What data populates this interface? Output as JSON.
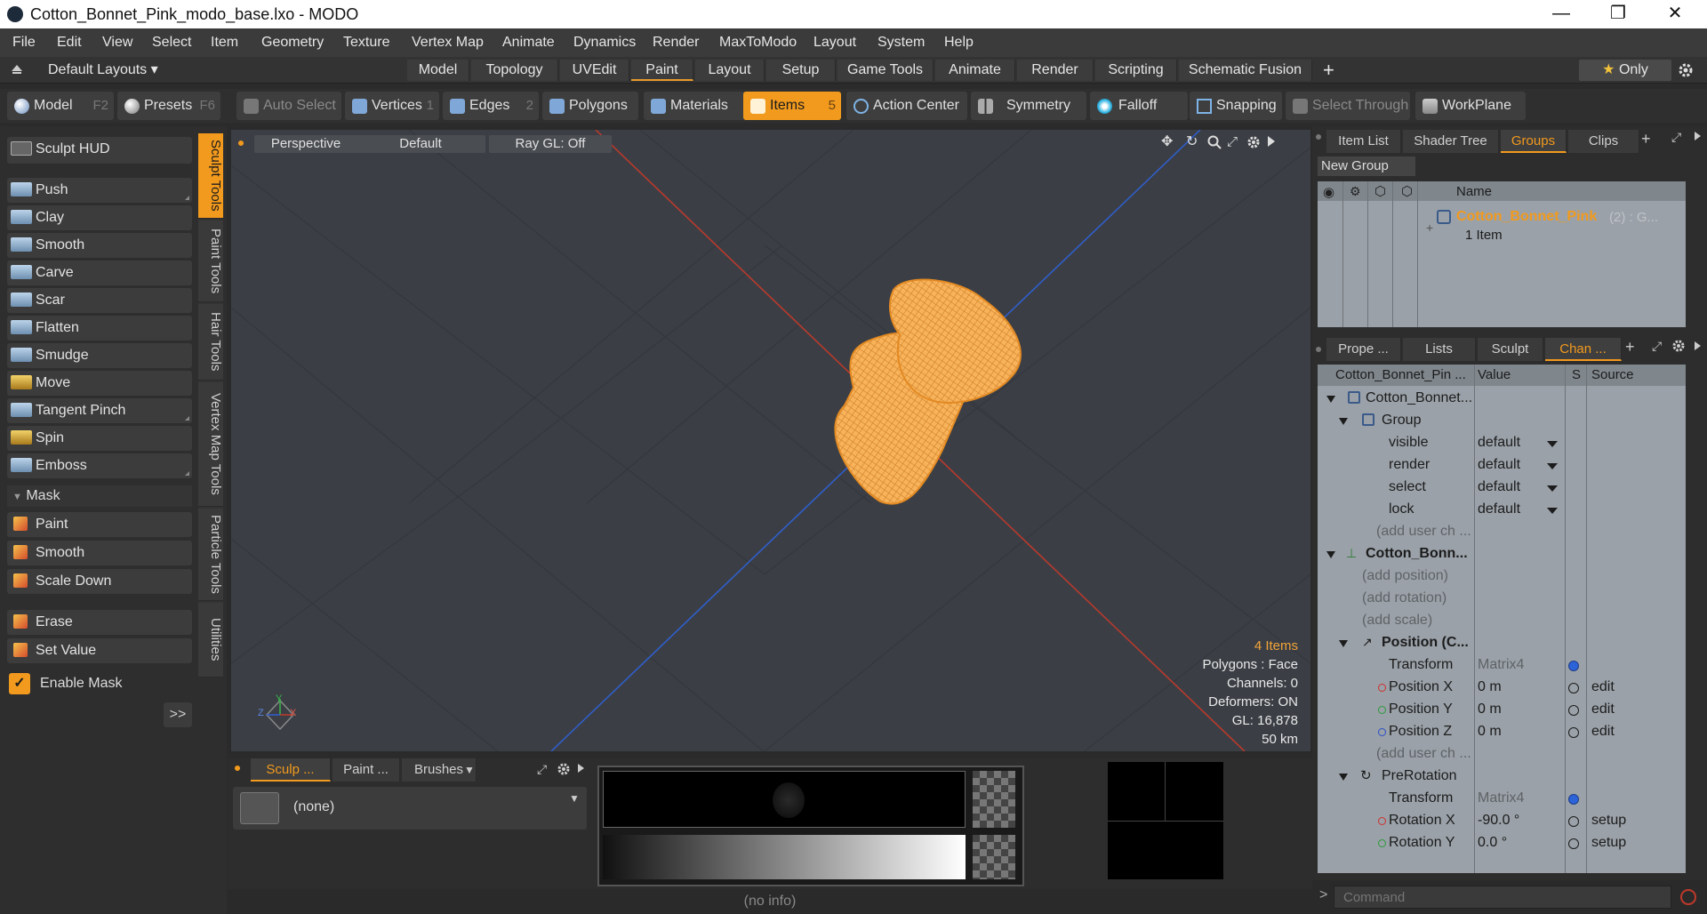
{
  "window": {
    "title": "Cotton_Bonnet_Pink_modo_base.lxo - MODO",
    "minimize": "—",
    "maximize": "❐",
    "close": "✕"
  },
  "menu": [
    "File",
    "Edit",
    "View",
    "Select",
    "Item",
    "Geometry",
    "Texture",
    "Vertex Map",
    "Animate",
    "Dynamics",
    "Render",
    "MaxToModo",
    "Layout",
    "System",
    "Help"
  ],
  "layoutbar": {
    "layouts_label": "Default Layouts",
    "tabs": [
      "Model",
      "Topology",
      "UVEdit",
      "Paint",
      "Layout",
      "Setup",
      "Game Tools",
      "Animate",
      "Render",
      "Scripting",
      "Schematic Fusion"
    ],
    "active_tab": "Paint",
    "add": "+",
    "only": "Only",
    "star": "★"
  },
  "toolbar": {
    "model": "Model",
    "model_key": "F2",
    "presets": "Presets",
    "presets_key": "F6",
    "auto_select": "Auto Select",
    "vertices": "Vertices",
    "vertices_count": "1",
    "edges": "Edges",
    "edges_count": "2",
    "polygons": "Polygons",
    "materials": "Materials",
    "items": "Items",
    "items_count": "5",
    "action_center": "Action Center",
    "symmetry": "Symmetry",
    "falloff": "Falloff",
    "snapping": "Snapping",
    "select_through": "Select Through",
    "workplane": "WorkPlane"
  },
  "sculpt": {
    "hud": "Sculpt HUD",
    "tools": [
      "Push",
      "Clay",
      "Smooth",
      "Carve",
      "Scar",
      "Flatten",
      "Smudge",
      "Move",
      "Tangent Pinch",
      "Spin",
      "Emboss"
    ],
    "mask_header": "Mask",
    "mask_tools": [
      "Paint",
      "Smooth",
      "Scale Down"
    ],
    "more_tools": [
      "Erase",
      "Set Value"
    ],
    "enable_mask": "Enable Mask",
    "expand": ">>",
    "vtabs": [
      "Sculpt Tools",
      "Paint Tools",
      "Hair Tools",
      "Vertex Map Tools",
      "Particle Tools",
      "Utilities"
    ]
  },
  "viewport": {
    "perspective": "Perspective",
    "default": "Default",
    "raygl": "Ray GL: Off",
    "stats": {
      "items": "4 Items",
      "polygons": "Polygons : Face",
      "channels": "Channels: 0",
      "deformers": "Deformers: ON",
      "gl": "GL: 16,878",
      "scale": "50 km"
    },
    "axis_x": "X",
    "axis_y": "Y",
    "axis_z": "Z"
  },
  "groups_panel": {
    "tabs": [
      "Item List",
      "Shader Tree",
      "Groups",
      "Clips"
    ],
    "active": "Groups",
    "new_group": "New Group",
    "name_header": "Name",
    "group_name": "Cotton_Bonnet_Pink",
    "group_suffix": "(2) : G...",
    "group_sub": "1 Item"
  },
  "channels_panel": {
    "tabs": [
      "Prope ...",
      "Lists",
      "Sculpt",
      "Chan ..."
    ],
    "active": "Chan ...",
    "headers": {
      "name": "Cotton_Bonnet_Pin ...",
      "value": "Value",
      "s": "S",
      "source": "Source"
    },
    "rows": [
      {
        "name": "Cotton_Bonnet...",
        "value": "",
        "src": ""
      },
      {
        "name": "Group",
        "value": "",
        "src": ""
      },
      {
        "name": "visible",
        "value": "default",
        "src": ""
      },
      {
        "name": "render",
        "value": "default",
        "src": ""
      },
      {
        "name": "select",
        "value": "default",
        "src": ""
      },
      {
        "name": "lock",
        "value": "default",
        "src": ""
      },
      {
        "name": "(add user ch ...",
        "value": "",
        "src": ""
      },
      {
        "name": "Cotton_Bonn...",
        "value": "",
        "src": ""
      },
      {
        "name": "(add position)",
        "value": "",
        "src": ""
      },
      {
        "name": "(add rotation)",
        "value": "",
        "src": ""
      },
      {
        "name": "(add scale)",
        "value": "",
        "src": ""
      },
      {
        "name": "Position (C...",
        "value": "",
        "src": ""
      },
      {
        "name": "Transform",
        "value": "Matrix4",
        "src": ""
      },
      {
        "name": "Position X",
        "value": "0 m",
        "src": "edit"
      },
      {
        "name": "Position Y",
        "value": "0 m",
        "src": "edit"
      },
      {
        "name": "Position Z",
        "value": "0 m",
        "src": "edit"
      },
      {
        "name": "(add user ch ...",
        "value": "",
        "src": ""
      },
      {
        "name": "PreRotation",
        "value": "",
        "src": ""
      },
      {
        "name": "Transform",
        "value": "Matrix4",
        "src": ""
      },
      {
        "name": "Rotation X",
        "value": "-90.0 °",
        "src": "setup"
      },
      {
        "name": "Rotation Y",
        "value": "0.0 °",
        "src": "setup"
      }
    ]
  },
  "bottom": {
    "tabs": [
      "Sculp ...",
      "Paint ...",
      "Brushes"
    ],
    "active": "Sculp ...",
    "none": "(none)"
  },
  "status": {
    "info": "(no info)",
    "command_placeholder": "Command"
  },
  "colors": {
    "accent": "#f29a1d",
    "mesh": "#f5a446",
    "x_axis": "#c0392b",
    "z_axis": "#2f5fd1"
  }
}
